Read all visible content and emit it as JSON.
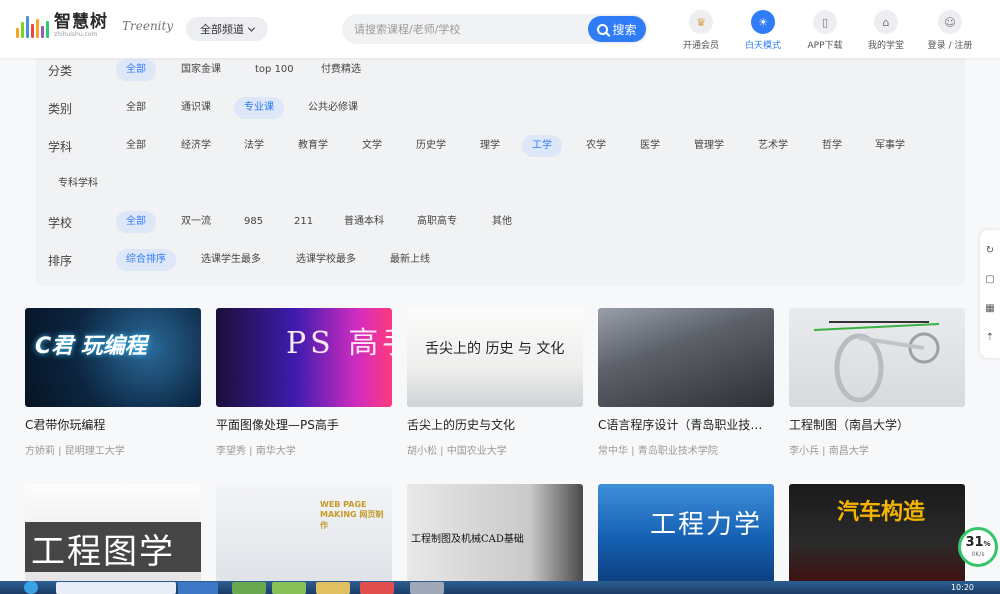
{
  "header": {
    "logo_cn": "智慧树",
    "logo_url": "zhihuishu.com",
    "logo_en": "Treenity",
    "channel_label": "全部频道",
    "search_placeholder": "请搜索课程/老师/学校",
    "search_button": "搜索",
    "nav": [
      {
        "label": "开通会员",
        "icon": "crown-icon",
        "glyph": "♛",
        "active": false
      },
      {
        "label": "白天模式",
        "icon": "sun-icon",
        "glyph": "☀",
        "active": true
      },
      {
        "label": "APP下载",
        "icon": "phone-icon",
        "glyph": "▯",
        "active": false
      },
      {
        "label": "我的学堂",
        "icon": "home-icon",
        "glyph": "⌂",
        "active": false
      },
      {
        "label": "登录 / 注册",
        "icon": "user-icon",
        "glyph": "☺",
        "active": false
      }
    ]
  },
  "filters": {
    "category": {
      "label": "分类",
      "options": [
        "全部",
        "国家金课",
        "top 100",
        "付费精选"
      ]
    },
    "type": {
      "label": "类别",
      "options": [
        "全部",
        "通识课",
        "专业课",
        "公共必修课"
      ]
    },
    "subject": {
      "label": "学科",
      "options": [
        "全部",
        "经济学",
        "法学",
        "教育学",
        "文学",
        "历史学",
        "理学",
        "工学",
        "农学",
        "医学",
        "管理学",
        "艺术学",
        "哲学",
        "军事学"
      ],
      "extra": "专科学科"
    },
    "school": {
      "label": "学校",
      "options": [
        "全部",
        "双一流",
        "985",
        "211",
        "普通本科",
        "高职高专",
        "其他"
      ]
    },
    "sort": {
      "label": "排序",
      "options": [
        "综合排序",
        "选课学生最多",
        "选课学校最多",
        "最新上线"
      ]
    }
  },
  "courses": [
    {
      "title": "C君带你玩编程",
      "meta": "方娇莉 | 昆明理工大学",
      "overlay": "C君 玩编程"
    },
    {
      "title": "平面图像处理—PS高手",
      "meta": "李望秀 | 南华大学",
      "overlay": "PS 高手"
    },
    {
      "title": "舌尖上的历史与文化",
      "meta": "胡小松 | 中国农业大学",
      "overlay": "舌尖上的 历史 与 文化"
    },
    {
      "title": "C语言程序设计（青岛职业技术学院）",
      "meta": "常中华 | 青岛职业技术学院",
      "overlay": ""
    },
    {
      "title": "工程制图（南昌大学）",
      "meta": "李小兵 | 南昌大学",
      "overlay": ""
    }
  ],
  "courses_row2": [
    {
      "overlay": "工程图学"
    },
    {
      "overlay": "WEB PAGE MAKING 网页制作"
    },
    {
      "overlay": "工程制图及机械CAD基础"
    },
    {
      "overlay": "工程力学"
    },
    {
      "overlay": "汽车构造"
    }
  ],
  "float_icons": [
    "refresh-icon",
    "message-icon",
    "qrcode-icon",
    "top-icon"
  ],
  "speed": {
    "percent": "31",
    "unit": "%",
    "rate": "0K/s"
  },
  "taskbar": {
    "time": "10:20"
  },
  "colors": {
    "accent": "#2f7cf6",
    "selected_bg": "#dde7f8",
    "filter_bg": "#f1f2f4"
  }
}
